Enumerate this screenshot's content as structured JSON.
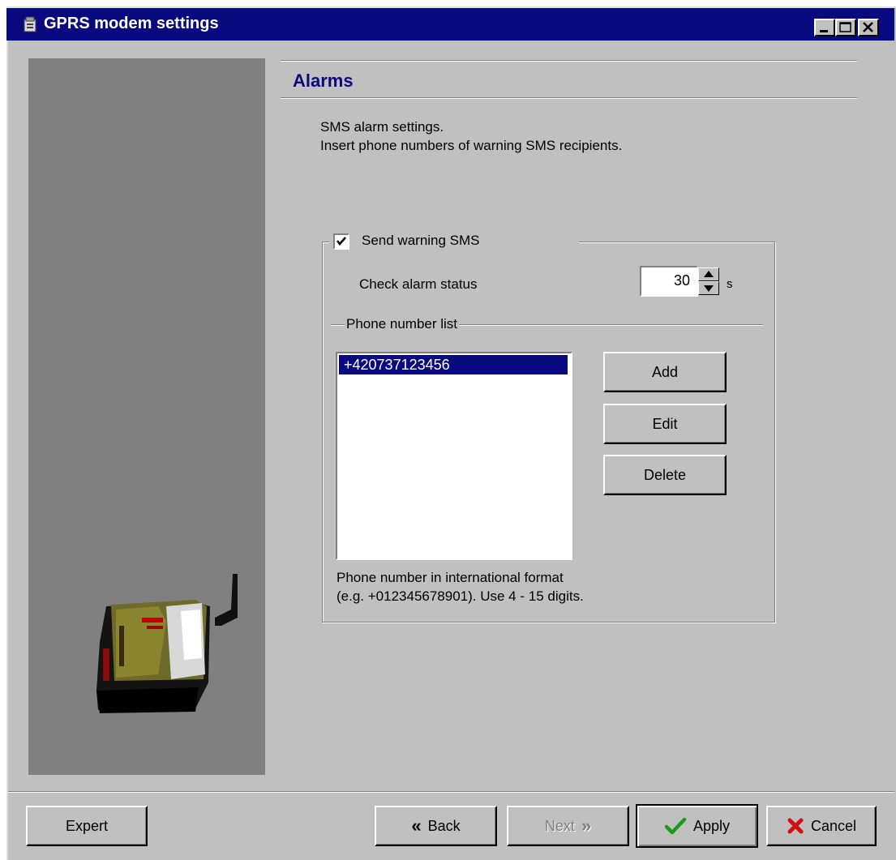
{
  "window": {
    "title": "GPRS modem settings"
  },
  "page": {
    "heading": "Alarms",
    "description_line1": "SMS alarm settings.",
    "description_line2": "Insert phone numbers of warning SMS recipients."
  },
  "sms_group": {
    "send_warning_label": "Send warning SMS",
    "send_warning_checked": true,
    "check_alarm_label": "Check alarm status",
    "check_alarm_value": "30",
    "check_alarm_unit": "s",
    "phone_list_label": "Phone number list",
    "phone_numbers": [
      "+420737123456"
    ],
    "add_label": "Add",
    "edit_label": "Edit",
    "delete_label": "Delete",
    "hint_line1": "Phone number in international format",
    "hint_line2": "(e.g. +012345678901). Use 4 - 15 digits."
  },
  "footer": {
    "expert_label": "Expert",
    "back_label": "Back",
    "next_label": "Next",
    "apply_label": "Apply",
    "cancel_label": "Cancel"
  },
  "icons": {
    "back": "double-chevron-left-icon",
    "next": "double-chevron-right-icon",
    "apply": "checkmark-icon",
    "cancel": "red-x-icon"
  },
  "colors": {
    "titlebar": "#0a0a80",
    "heading": "#0a0a80",
    "selection": "#0a0a80",
    "apply_check": "#1a9a1a",
    "cancel_x": "#d01010"
  }
}
